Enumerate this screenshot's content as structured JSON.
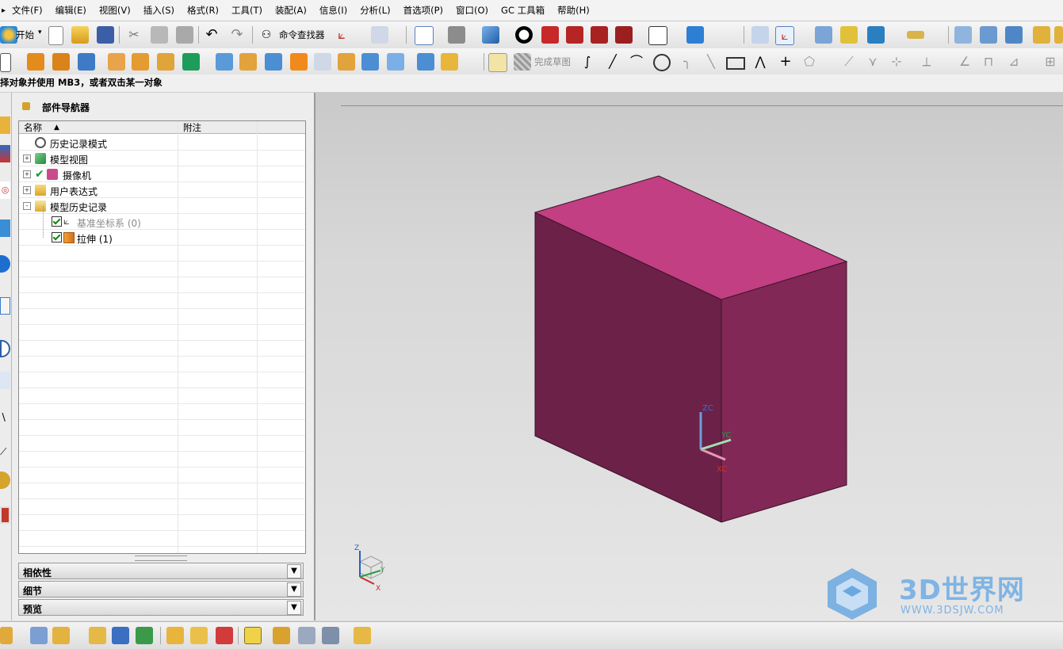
{
  "menu": [
    "文件(F)",
    "编辑(E)",
    "视图(V)",
    "插入(S)",
    "格式(R)",
    "工具(T)",
    "装配(A)",
    "信息(I)",
    "分析(L)",
    "首选项(P)",
    "窗口(O)",
    "GC 工具箱",
    "帮助(H)"
  ],
  "toolbar1": {
    "start_label": "开始",
    "command_finder_label": "命令查找器"
  },
  "toolbar2": {
    "finish_sketch_label": "完成草图"
  },
  "status": {
    "prompt": "择对象并使用 MB3，或者双击某一对象"
  },
  "navigator": {
    "title": "部件导航器",
    "columns": [
      "名称",
      "附注"
    ],
    "rows": [
      {
        "label": "历史记录模式",
        "icon": "clock-icon",
        "expand": "",
        "grey": false
      },
      {
        "label": "模型视图",
        "icon": "cube-view-icon",
        "expand": "+",
        "grey": false
      },
      {
        "label": "摄像机",
        "icon": "camera-icon",
        "expand": "+",
        "grey": false
      },
      {
        "label": "用户表达式",
        "icon": "folder-icon",
        "expand": "+",
        "grey": false
      },
      {
        "label": "模型历史记录",
        "icon": "folder-open-icon",
        "expand": "-",
        "grey": false
      },
      {
        "label": "基准坐标系 (0)",
        "icon": "datum-csys-icon",
        "expand": "",
        "grey": true
      },
      {
        "label": "拉伸 (1)",
        "icon": "extrude-icon",
        "expand": "",
        "grey": false
      }
    ],
    "panels": [
      "相依性",
      "细节",
      "预览"
    ]
  },
  "viewport": {
    "triad": {
      "zc": "ZC",
      "yc": "YC",
      "xc": "XC"
    },
    "mini_triad": {
      "z": "Z",
      "y": "Y",
      "x": "X"
    },
    "colors": {
      "top": "#c13f82",
      "front": "#6c2148",
      "side": "#812856"
    }
  },
  "watermark": {
    "title": "3D世界网",
    "url": "WWW.3DSJW.COM"
  }
}
